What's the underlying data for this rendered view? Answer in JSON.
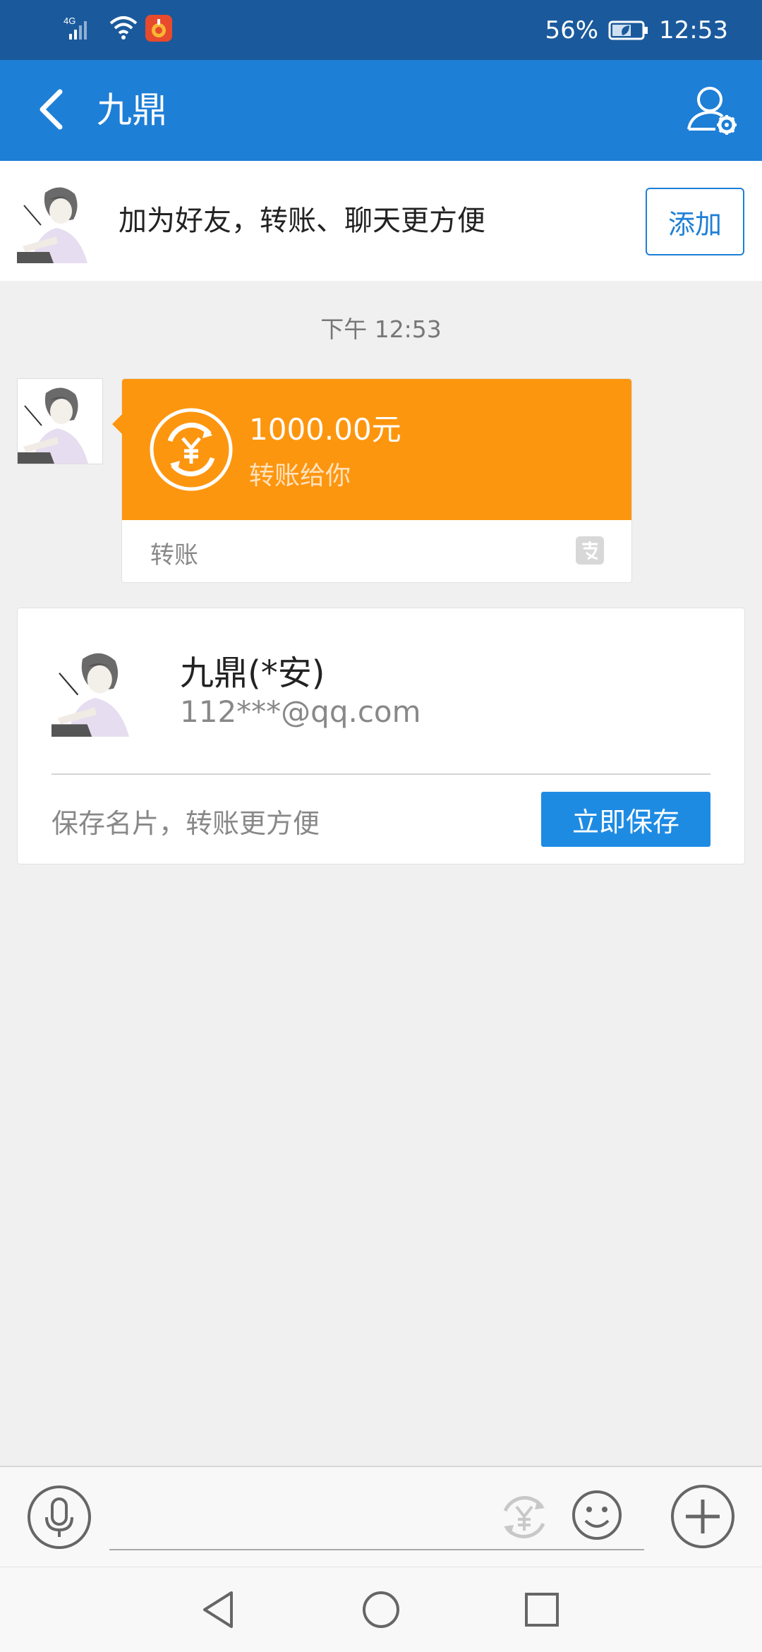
{
  "status_bar": {
    "network": "4G",
    "battery_percent": "56%",
    "time": "12:53",
    "icons": [
      "signal-icon",
      "wifi-icon",
      "app-notification-icon",
      "battery-icon"
    ]
  },
  "header": {
    "title": "九鼎",
    "icons": [
      "back-arrow-icon",
      "contact-settings-icon"
    ]
  },
  "add_friend_banner": {
    "text": "加为好友，转账、聊天更方便",
    "button_label": "添加"
  },
  "chat": {
    "timestamp": "下午 12:53",
    "transfer_message": {
      "amount": "1000.00元",
      "subtitle": "转账给你",
      "footer_label": "转账",
      "colors": {
        "card": "#fd960f"
      },
      "icons": [
        "transfer-yuan-icon",
        "alipay-logo-icon"
      ]
    },
    "contact_card": {
      "name": "九鼎(*安)",
      "account": "112***@qq.com",
      "hint": "保存名片，转账更方便",
      "save_label": "立即保存"
    }
  },
  "input_bar": {
    "icons": [
      "voice-icon",
      "transfer-icon",
      "emoji-icon",
      "plus-icon"
    ]
  },
  "nav_bar": {
    "icons": [
      "nav-back-icon",
      "nav-home-icon",
      "nav-recents-icon"
    ]
  },
  "colors": {
    "status_bar": "#1a5a9c",
    "title_bar": "#1e7fd6",
    "accent": "#1e8be3",
    "background": "#f0f0f0"
  }
}
